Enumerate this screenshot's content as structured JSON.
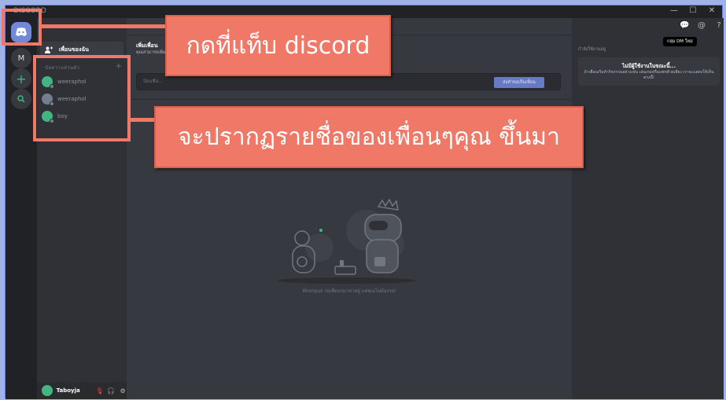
{
  "window": {
    "app_title": "DISCORD",
    "controls": [
      "—",
      "☐",
      "✕"
    ]
  },
  "rail": {
    "server_initial": "M"
  },
  "dm_sidebar": {
    "friends_label": "เพื่อนของฉัน",
    "section_header": "ข้อความส่วนตัว",
    "items": [
      {
        "name": "weeraphol"
      },
      {
        "name": "weeraphol"
      },
      {
        "name": "boy"
      }
    ]
  },
  "user": {
    "name": "Taboyja"
  },
  "main": {
    "add_title": "เพิ่มเพื่อน",
    "add_subtitle": "คุณสามารถเพิ่ม...",
    "input_placeholder": "ป้อนชื่อ...",
    "send_button": "ส่งคำขอเป็นเพื่อน",
    "empty_text": "Wumpus รอเพื่อนๆมาหาอยู่ แต่คุณไม่ต้องรอ!"
  },
  "right_panel": {
    "tooltip": "กลุ่ม DM ใหม่",
    "label": "กำลังใช้งานอยู่",
    "card_title": "ไม่มีผู้ใช้งานในขณะนี้...",
    "card_body": "ถ้าเพื่อนเริ่มทำกิจกรรมอย่างเช่น เล่นเกมหรือแชทด้วยเสียง เราจะแสดงให้เห็นตรงนี้!"
  },
  "annotations": {
    "callout_1": "กดที่แท็บ discord",
    "callout_2": "จะปรากฏรายชื่อของเพื่อนๆคุณ ขึ้นมา"
  },
  "colors": {
    "annotation": "#ef7866",
    "blurple": "#7289da",
    "online_green": "#43b581"
  }
}
